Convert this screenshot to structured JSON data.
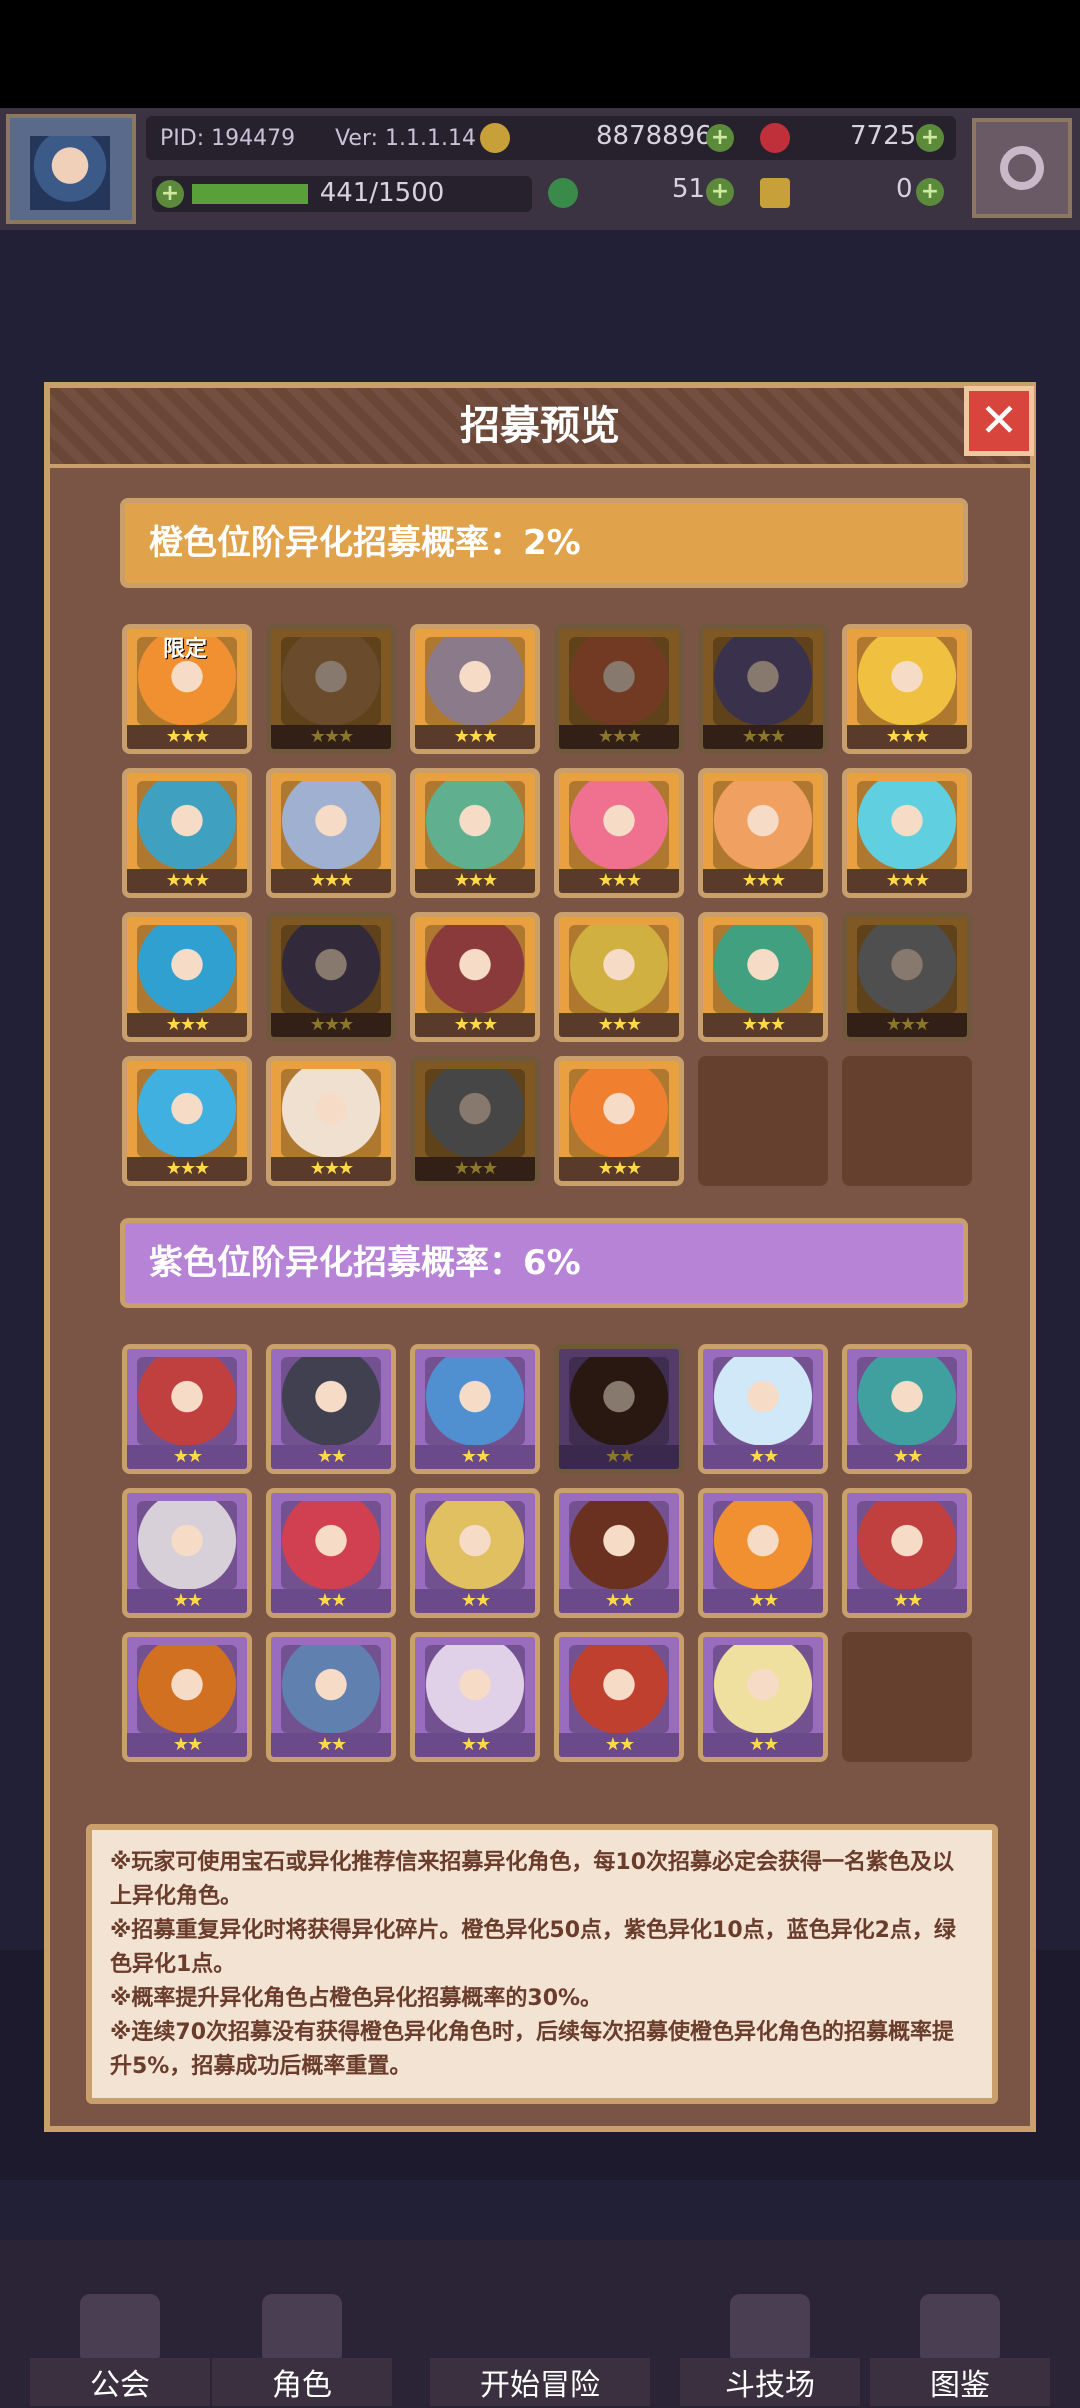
{
  "hud": {
    "pid": "PID: 194479",
    "version": "Ver: 1.1.1.14",
    "gold": "8878896",
    "gems": "7725",
    "xp": "441/1500",
    "clover": "51",
    "key": "0"
  },
  "modal": {
    "title": "招募预览",
    "close_label": "✕",
    "orange_section": "橙色位阶异化招募概率：2%",
    "purple_section": "紫色位阶异化招募概率：6%",
    "limited_badge": "限定",
    "orange_stars": "★★★",
    "purple_stars": "★★"
  },
  "orange_cards": [
    {
      "color": "#f09030",
      "dim": false,
      "limited": true
    },
    {
      "color": "#c08a50",
      "dim": true
    },
    {
      "color": "#8a7a8a",
      "dim": false
    },
    {
      "color": "#d06a40",
      "dim": true
    },
    {
      "color": "#6a5a8a",
      "dim": true
    },
    {
      "color": "#f0c040",
      "dim": false
    },
    {
      "color": "#40a0c0",
      "dim": false
    },
    {
      "color": "#a0b0d0",
      "dim": false
    },
    {
      "color": "#60b090",
      "dim": false
    },
    {
      "color": "#f07090",
      "dim": false
    },
    {
      "color": "#f0a060",
      "dim": false
    },
    {
      "color": "#60d0e0",
      "dim": false
    },
    {
      "color": "#30a0d0",
      "dim": false
    },
    {
      "color": "#5a4a6a",
      "dim": true
    },
    {
      "color": "#8a3a3a",
      "dim": false
    },
    {
      "color": "#d0b040",
      "dim": false
    },
    {
      "color": "#40a080",
      "dim": false
    },
    {
      "color": "#909090",
      "dim": true
    },
    {
      "color": "#40b0e0",
      "dim": false
    },
    {
      "color": "#f0e0d0",
      "dim": false
    },
    {
      "color": "#808080",
      "dim": true
    },
    {
      "color": "#f08030",
      "dim": false
    }
  ],
  "purple_cards": [
    {
      "color": "#c04040",
      "dim": false
    },
    {
      "color": "#404050",
      "dim": false
    },
    {
      "color": "#5090d0",
      "dim": false
    },
    {
      "color": "#4a2a20",
      "dim": true
    },
    {
      "color": "#d0e8f8",
      "dim": false
    },
    {
      "color": "#40a0a0",
      "dim": false
    },
    {
      "color": "#d8d0d8",
      "dim": false
    },
    {
      "color": "#d04050",
      "dim": false
    },
    {
      "color": "#e0c060",
      "dim": false
    },
    {
      "color": "#6a3020",
      "dim": false
    },
    {
      "color": "#f09030",
      "dim": false
    },
    {
      "color": "#c04040",
      "dim": false
    },
    {
      "color": "#d07020",
      "dim": false
    },
    {
      "color": "#6080b0",
      "dim": false
    },
    {
      "color": "#e0d0e8",
      "dim": false
    },
    {
      "color": "#c04030",
      "dim": false
    },
    {
      "color": "#f0e0a0",
      "dim": false
    }
  ],
  "notes": [
    "※玩家可使用宝石或异化推荐信来招募异化角色，每10次招募必定会获得一名紫色及以上异化角色。",
    "※招募重复异化时将获得异化碎片。橙色异化50点，紫色异化10点，蓝色异化2点，绿色异化1点。",
    "※概率提升异化角色占橙色异化招募概率的30%。",
    "※连续70次招募没有获得橙色异化角色时，后续每次招募使橙色异化角色的招募概率提升5%，招募成功后概率重置。"
  ],
  "nav": [
    {
      "label": "公会"
    },
    {
      "label": "角色"
    },
    {
      "label": "开始冒险"
    },
    {
      "label": "斗技场"
    },
    {
      "label": "图鉴"
    }
  ]
}
